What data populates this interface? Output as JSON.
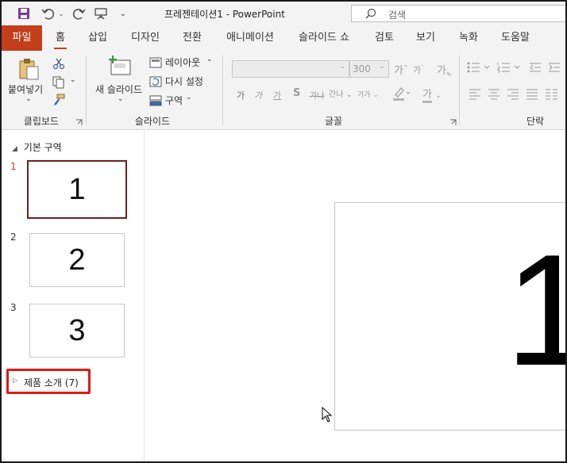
{
  "window": {
    "title": "프레젠테이션1  -  PowerPoint",
    "search_placeholder": "검색"
  },
  "quick_access": [
    {
      "name": "save-icon"
    },
    {
      "name": "undo-icon"
    },
    {
      "name": "redo-icon"
    },
    {
      "name": "present-icon"
    },
    {
      "name": "customize-icon"
    }
  ],
  "tabs": [
    "파일",
    "홈",
    "삽입",
    "디자인",
    "전환",
    "애니메이션",
    "슬라이드 쇼",
    "검토",
    "보기",
    "녹화",
    "도움말"
  ],
  "active_tab": "홈",
  "colors": {
    "accent": "#c43e1c",
    "highlight": "#e21818",
    "selected_thumb": "#6b1f1f"
  },
  "ribbon": {
    "clipboard": {
      "paste_label": "붙여넣기",
      "group_label": "클립보드"
    },
    "slides": {
      "new_slide_label": "새 슬라이드",
      "layout_label": "레이아웃",
      "reset_label": "다시 설정",
      "section_label": "구역",
      "group_label": "슬라이드"
    },
    "font": {
      "size_value": "300",
      "grow_label": "가",
      "shrink_label": "가",
      "clear_label": "가",
      "bold": "가",
      "italic": "가",
      "underline": "가",
      "shadow": "S",
      "strike": "가나",
      "spacing": "간나",
      "case": "가가",
      "font_color": "가",
      "group_label": "글꼴"
    },
    "paragraph": {
      "group_label": "단락"
    }
  },
  "slide_pane": {
    "section1": "기본 구역",
    "slides": [
      {
        "number": "1",
        "content": "1"
      },
      {
        "number": "2",
        "content": "2"
      },
      {
        "number": "3",
        "content": "3"
      }
    ],
    "section2": "제품 소개 (7)"
  },
  "current_slide": {
    "content": "1"
  }
}
